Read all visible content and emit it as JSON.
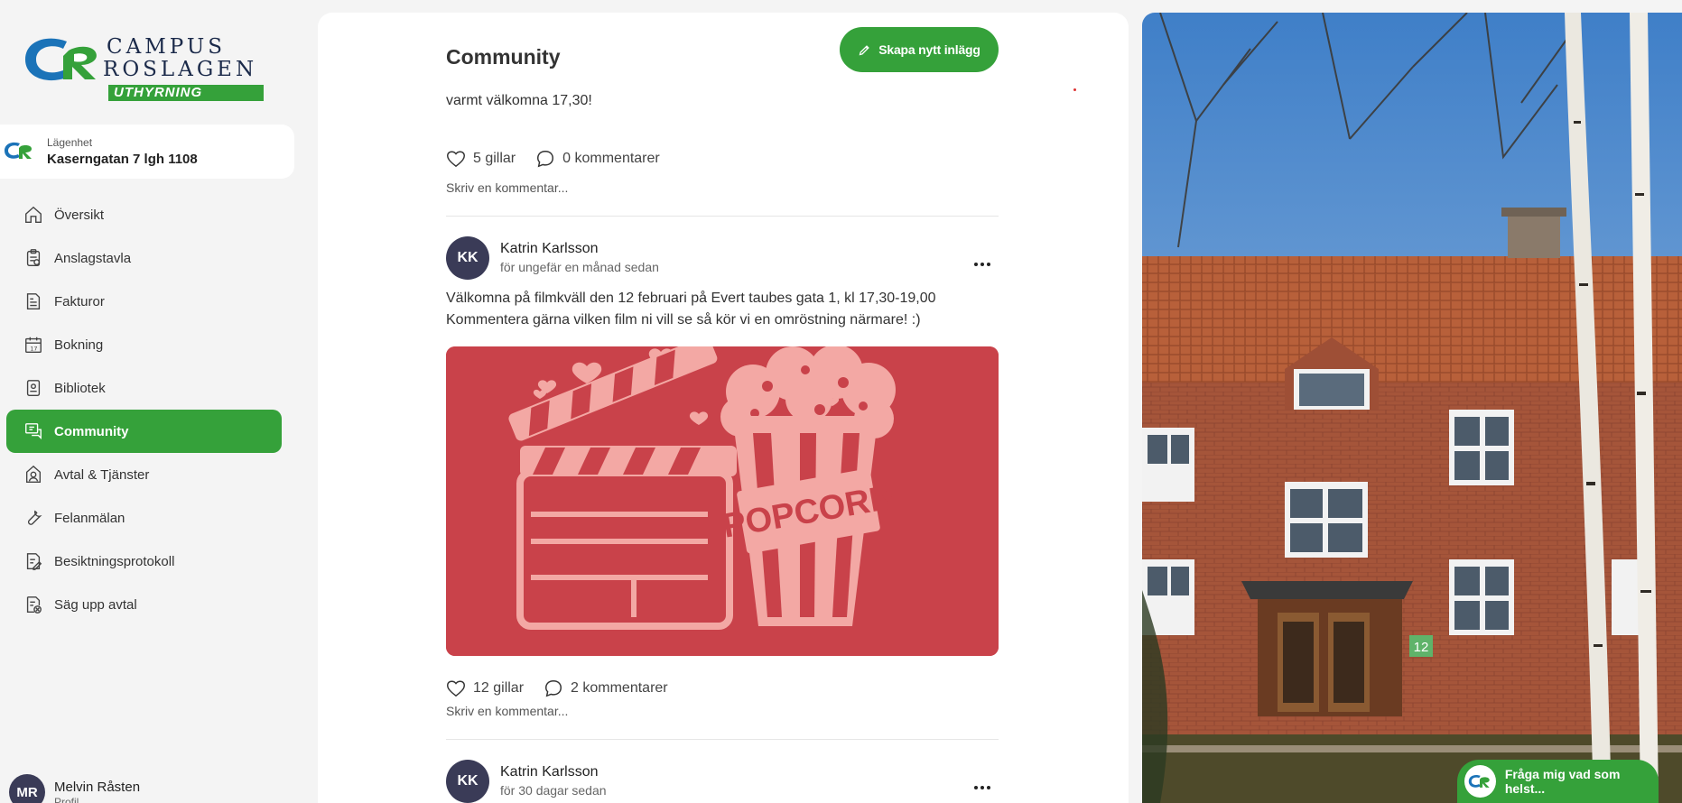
{
  "brand": {
    "line1": "CAMPUS",
    "line2": "ROSLAGEN",
    "band": "UTHYRNING",
    "green": "#35a13a",
    "navy": "#1b2a4a",
    "blue": "#1b73b8"
  },
  "apartment": {
    "label": "Lägenhet",
    "value": "Kaserngatan 7 lgh 1108"
  },
  "nav": [
    {
      "label": "Översikt",
      "icon": "home-icon"
    },
    {
      "label": "Anslagstavla",
      "icon": "clipboard-icon"
    },
    {
      "label": "Fakturor",
      "icon": "invoice-icon"
    },
    {
      "label": "Bokning",
      "icon": "calendar-icon"
    },
    {
      "label": "Bibliotek",
      "icon": "library-icon"
    },
    {
      "label": "Community",
      "icon": "chat-icon",
      "active": true
    },
    {
      "label": "Avtal & Tjänster",
      "icon": "contract-icon"
    },
    {
      "label": "Felanmälan",
      "icon": "wrench-icon"
    },
    {
      "label": "Besiktningsprotokoll",
      "icon": "inspection-icon"
    },
    {
      "label": "Säg upp avtal",
      "icon": "cancel-contract-icon"
    }
  ],
  "profile": {
    "initials": "MR",
    "name": "Melvin Råsten",
    "sub": "Profil"
  },
  "main": {
    "title": "Community",
    "create_label": "Skapa nytt inlägg",
    "comment_placeholder": "Skriv en kommentar...",
    "posts": [
      {
        "text": "varmt välkomna 17,30!",
        "likes": "5 gillar",
        "comments": "0 kommentarer"
      },
      {
        "initials": "KK",
        "author": "Katrin Karlsson",
        "time": "för ungefär en månad sedan",
        "text_line1": "Välkomna på filmkväll den 12 februari på Evert taubes gata 1, kl 17,30-19,00",
        "text_line2": "Kommentera gärna vilken film ni vill se så kör vi en omröstning närmare! :)",
        "image_word": "POPCORN",
        "likes": "12 gillar",
        "comments": "2 kommentarer"
      },
      {
        "initials": "KK",
        "author": "Katrin Karlsson",
        "time": "för 30 dagar sedan"
      }
    ]
  },
  "photo": {
    "house_number": "12"
  },
  "assistant": {
    "label": "Fråga mig vad som helst..."
  }
}
